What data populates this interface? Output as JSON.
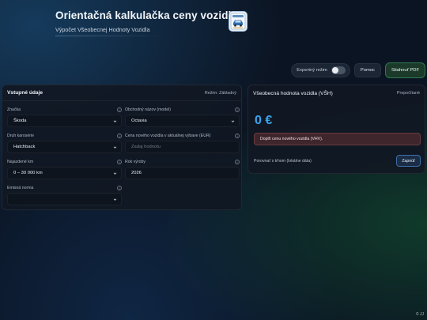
{
  "header": {
    "title": "Orientačná kalkulačka ceny vozidla",
    "subtitle": "Výpočet Všeobecnej Hodnoty Vozidla",
    "logo_icon": "car-document-icon"
  },
  "toolbar": {
    "expert_mode_label": "Expertný režim",
    "expert_mode_on": false,
    "help_label": "Pomoc",
    "download_pdf_label": "Stiahnuť PDF"
  },
  "input_card": {
    "title": "Vstupné údaje",
    "mode_text": "Režim: Základný",
    "fields": {
      "brand": {
        "label": "Značka",
        "value": "Škoda"
      },
      "model": {
        "label": "Obchodný názov (model)",
        "value": "Octavia"
      },
      "body_type": {
        "label": "Druh karosérie",
        "value": "Hatchback"
      },
      "new_price": {
        "label": "Cena nového vozidla v aktuálnej výbave (EUR)",
        "placeholder": "Zadaj hodnotu"
      },
      "mileage": {
        "label": "Najazdené km",
        "value": "0 – 30 000 km"
      },
      "year": {
        "label": "Rok výroby",
        "value": "2026"
      },
      "emission": {
        "label": "Emisná norma",
        "value": ""
      }
    }
  },
  "result_card": {
    "title": "Všeobecná hodnota vozidla (VŠH)",
    "recalculated_text": "Prepočítané",
    "value": "0 €",
    "alert": "Doplň cenu nového vozidla (VHV).",
    "compare_label": "Porovnať s trhom (lokálne dáta)",
    "enable_label": "Zapnúť"
  },
  "footer": {
    "text": "© JJ"
  },
  "colors": {
    "accent_blue": "#3aa6ee",
    "pdf_green": "#2f7a4e",
    "alert_red": "#783737"
  }
}
